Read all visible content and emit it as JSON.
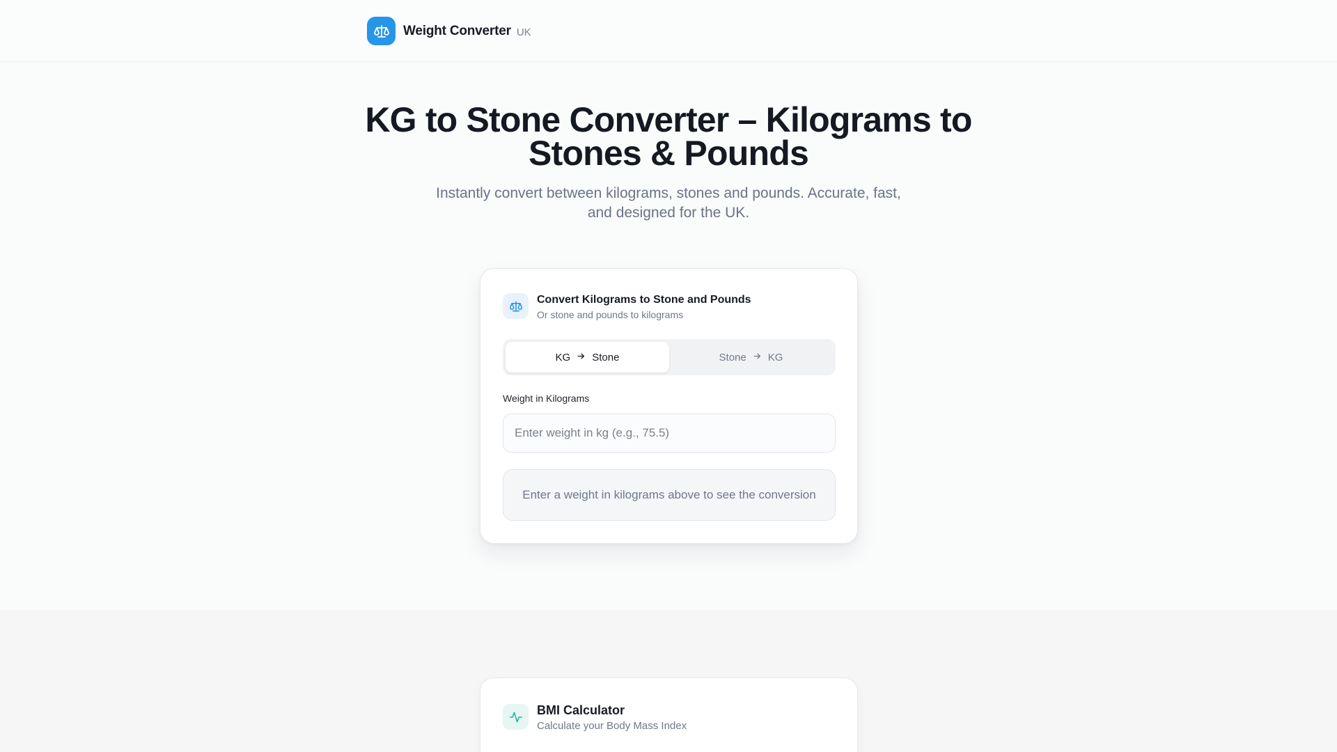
{
  "header": {
    "brand_name": "Weight Converter",
    "brand_tag": "UK",
    "logo_icon": "scale-icon",
    "accent_color": "#2795e8"
  },
  "hero": {
    "title": "KG to Stone Converter – Kilograms to Stones & Pounds",
    "subtitle": "Instantly convert between kilograms, stones and pounds. Accurate, fast, and designed for the UK."
  },
  "converter": {
    "icon": "scale-icon",
    "title": "Convert Kilograms to Stone and Pounds",
    "subtitle": "Or stone and pounds to kilograms",
    "tabs": [
      {
        "from": "KG",
        "to": "Stone",
        "active": true
      },
      {
        "from": "Stone",
        "to": "KG",
        "active": false
      }
    ],
    "field_label": "Weight in Kilograms",
    "input_value": "",
    "input_placeholder": "Enter weight in kg (e.g., 75.5)",
    "result_text": "Enter a weight in kilograms above to see the conversion"
  },
  "bmi": {
    "icon": "activity-icon",
    "title": "BMI Calculator",
    "subtitle": "Calculate your Body Mass Index",
    "accent_color": "#22b39a"
  }
}
